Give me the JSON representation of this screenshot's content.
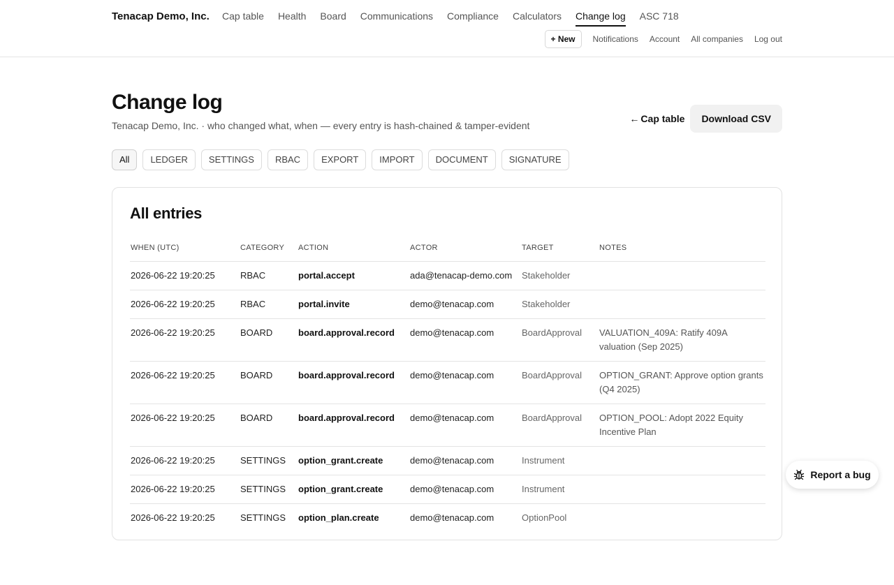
{
  "header": {
    "brand": "Tenacap Demo, Inc.",
    "nav": [
      {
        "label": "Cap table"
      },
      {
        "label": "Health"
      },
      {
        "label": "Board"
      },
      {
        "label": "Communications"
      },
      {
        "label": "Compliance"
      },
      {
        "label": "Calculators"
      },
      {
        "label": "Change log"
      },
      {
        "label": "ASC 718"
      }
    ],
    "active_nav": "Change log",
    "new_button": "+ New",
    "subnav": [
      {
        "label": "Notifications"
      },
      {
        "label": "Account"
      },
      {
        "label": "All companies"
      },
      {
        "label": "Log out"
      }
    ]
  },
  "page": {
    "title": "Change log",
    "subtitle": "Tenacap Demo, Inc. · who changed what, when — every entry is hash-chained & tamper-evident",
    "back_arrow": "←",
    "back_link": "Cap table",
    "download_button": "Download CSV"
  },
  "filters": {
    "active": "All",
    "chips": [
      {
        "label": "All"
      },
      {
        "label": "LEDGER"
      },
      {
        "label": "SETTINGS"
      },
      {
        "label": "RBAC"
      },
      {
        "label": "EXPORT"
      },
      {
        "label": "IMPORT"
      },
      {
        "label": "DOCUMENT"
      },
      {
        "label": "SIGNATURE"
      }
    ]
  },
  "table": {
    "title": "All entries",
    "columns": [
      "WHEN (UTC)",
      "CATEGORY",
      "ACTION",
      "ACTOR",
      "TARGET",
      "NOTES"
    ],
    "rows": [
      {
        "when": "2026-06-22 19:20:25",
        "category": "RBAC",
        "action": "portal.accept",
        "actor": "ada@tenacap-demo.com",
        "target": "Stakeholder",
        "notes": ""
      },
      {
        "when": "2026-06-22 19:20:25",
        "category": "RBAC",
        "action": "portal.invite",
        "actor": "demo@tenacap.com",
        "target": "Stakeholder",
        "notes": ""
      },
      {
        "when": "2026-06-22 19:20:25",
        "category": "BOARD",
        "action": "board.approval.record",
        "actor": "demo@tenacap.com",
        "target": "BoardApproval",
        "notes": "VALUATION_409A: Ratify 409A valuation (Sep 2025)"
      },
      {
        "when": "2026-06-22 19:20:25",
        "category": "BOARD",
        "action": "board.approval.record",
        "actor": "demo@tenacap.com",
        "target": "BoardApproval",
        "notes": "OPTION_GRANT: Approve option grants (Q4 2025)"
      },
      {
        "when": "2026-06-22 19:20:25",
        "category": "BOARD",
        "action": "board.approval.record",
        "actor": "demo@tenacap.com",
        "target": "BoardApproval",
        "notes": "OPTION_POOL: Adopt 2022 Equity Incentive Plan"
      },
      {
        "when": "2026-06-22 19:20:25",
        "category": "SETTINGS",
        "action": "option_grant.create",
        "actor": "demo@tenacap.com",
        "target": "Instrument",
        "notes": ""
      },
      {
        "when": "2026-06-22 19:20:25",
        "category": "SETTINGS",
        "action": "option_grant.create",
        "actor": "demo@tenacap.com",
        "target": "Instrument",
        "notes": ""
      },
      {
        "when": "2026-06-22 19:20:25",
        "category": "SETTINGS",
        "action": "option_plan.create",
        "actor": "demo@tenacap.com",
        "target": "OptionPool",
        "notes": ""
      }
    ]
  },
  "bug_button": {
    "label": "Report a bug",
    "icon": "bug-icon"
  }
}
